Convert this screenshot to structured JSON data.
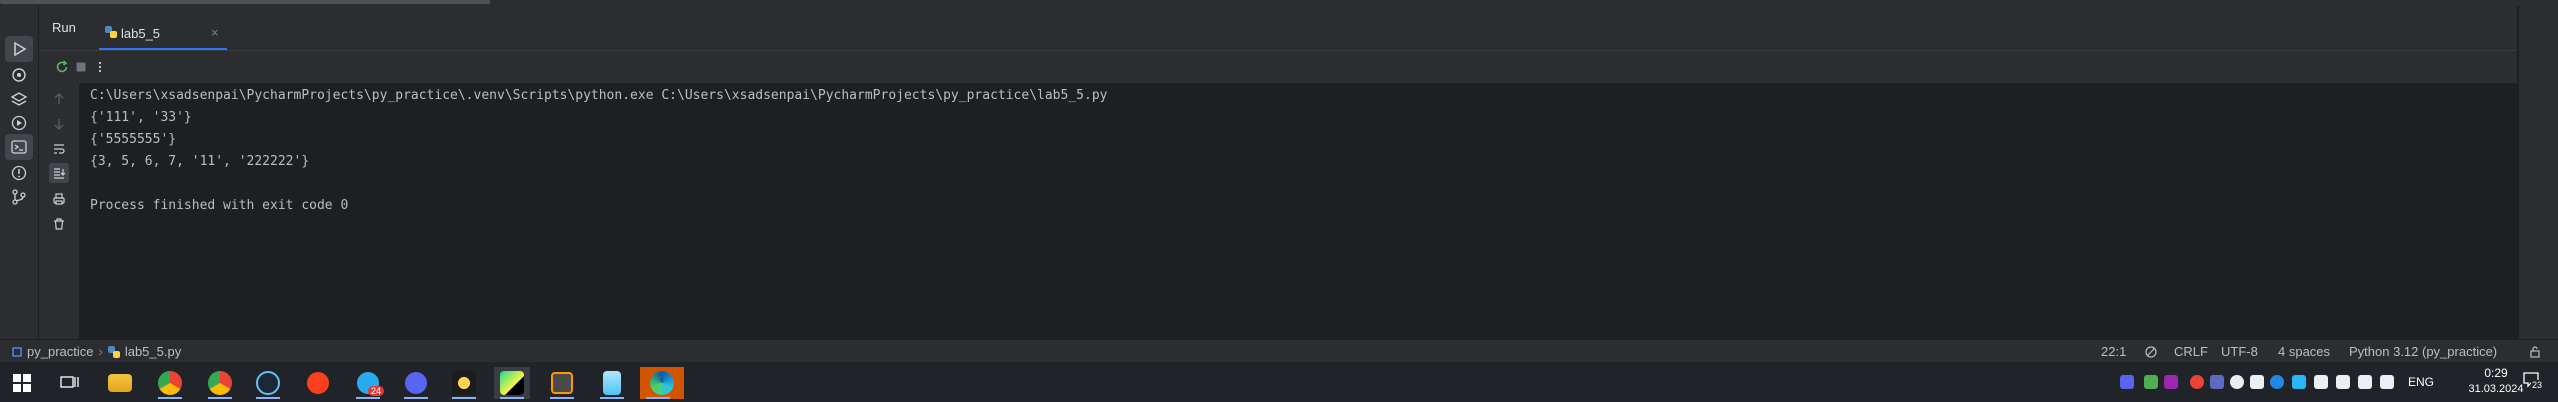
{
  "run_window": {
    "title": "Run",
    "tab": {
      "label": "lab5_5",
      "close": "×"
    }
  },
  "icons": {
    "left_strip": [
      "run-icon",
      "python-packages-icon",
      "layers-icon",
      "services-icon",
      "terminal-icon",
      "problems-icon",
      "git-icon"
    ],
    "toolbar": [
      "rerun-icon",
      "stop-icon",
      "more-options-icon"
    ],
    "gutter": [
      "up-arrow-icon",
      "down-arrow-icon",
      "soft-wrap-icon",
      "scroll-to-end-icon",
      "print-icon",
      "trash-icon"
    ]
  },
  "console": {
    "lines": [
      "C:\\Users\\xsadsenpai\\PycharmProjects\\py_practice\\.venv\\Scripts\\python.exe C:\\Users\\xsadsenpai\\PycharmProjects\\py_practice\\lab5_5.py",
      "{'111', '33'}",
      "{'5555555'}",
      "{3, 5, 6, 7, '11', '222222'}",
      "",
      "Process finished with exit code 0"
    ]
  },
  "status_bar": {
    "project": "py_practice",
    "file": "lab5_5.py",
    "position": "22:1",
    "line_ending": "CRLF",
    "encoding": "UTF-8",
    "indent": "4 spaces",
    "interpreter": "Python 3.12 (py_practice)"
  },
  "taskbar": {
    "apps": [
      "windows-start-icon",
      "task-view-icon",
      "file-explorer-icon",
      "chrome-icon",
      "chrome-profile-icon",
      "steam-icon",
      "yandex-browser-icon",
      "telegram-icon",
      "discord-icon",
      "app-icon",
      "pycharm-icon",
      "sublime-text-icon",
      "notepad-icon",
      "edge-icon"
    ],
    "telegram_badge": "24",
    "language": "ENG",
    "time": "0:29",
    "date": "31.03.2024",
    "notifications": "23"
  },
  "colors": {
    "accent": "#3574f0",
    "background": "#1e1f22",
    "panel": "#2b2d30",
    "text": "#bcbec4"
  }
}
